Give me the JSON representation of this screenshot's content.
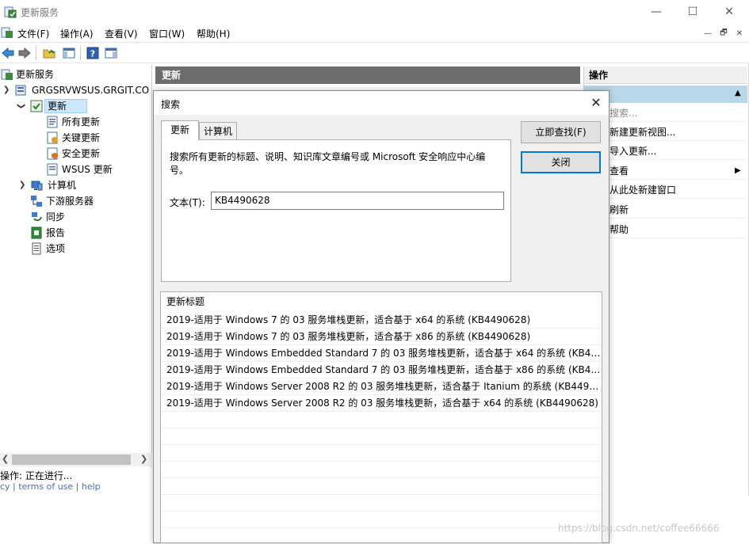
{
  "app": {
    "title": "更新服务",
    "colors": {
      "accent": "#0078d7",
      "selection": "#cce8ff",
      "header_dark": "#6c6c6c",
      "action_section": "#b9d7ea"
    }
  },
  "window_controls": {
    "minimize": "—",
    "maximize": "☐",
    "close": "✕"
  },
  "menubar": {
    "items": [
      "文件(F)",
      "操作(A)",
      "查看(V)",
      "窗口(W)",
      "帮助(H)"
    ]
  },
  "mdi_controls": [
    "—",
    "🗗",
    "✕"
  ],
  "toolbar": {
    "icons": [
      "back-arrow-icon",
      "forward-arrow-icon",
      "up-folder-icon",
      "show-hide-tree-icon",
      "help-icon",
      "show-hide-action-pane-icon"
    ]
  },
  "tree": {
    "root": "更新服务",
    "server": "GRGSRVWSUS.GRGIT.CO",
    "updates": "更新",
    "all_updates": "所有更新",
    "critical_updates": "关键更新",
    "security_updates": "安全更新",
    "wsus_updates": "WSUS 更新",
    "computers": "计算机",
    "downstream_servers": "下游服务器",
    "sync": "同步",
    "reports": "报告",
    "options": "选项"
  },
  "center": {
    "header": "更新"
  },
  "actions": {
    "header": "操作",
    "items": [
      "搜索...",
      "新建更新视图...",
      "导入更新...",
      "查看",
      "从此处新建窗口",
      "刷新",
      "帮助"
    ]
  },
  "status": {
    "text": "操作:  正在进行..."
  },
  "behind_links": {
    "text": "cy  |  terms of use  |  help"
  },
  "dialog": {
    "title": "搜索",
    "close": "✕",
    "tabs": [
      "更新",
      "计算机"
    ],
    "description": "搜索所有更新的标题、说明、知识库文章编号或 Microsoft 安全响应中心编号。",
    "text_label": "文本(T):",
    "text_value": "KB4490628",
    "find_now_button": "立即查找(F)",
    "close_button": "关闭",
    "results_header": "更新标题",
    "results": [
      "2019-适用于 Windows 7 的 03 服务堆栈更新，适合基于 x64 的系统 (KB4490628)",
      "2019-适用于 Windows 7 的 03 服务堆栈更新，适合基于 x86 的系统 (KB4490628)",
      "2019-适用于 Windows Embedded Standard 7 的 03 服务堆栈更新，适合基于 x64 的系统 (KB44...",
      "2019-适用于 Windows Embedded Standard 7 的 03 服务堆栈更新，适合基于 x86 的系统 (KB44...",
      "2019-适用于 Windows Server 2008 R2 的 03 服务堆栈更新，适合基于 Itanium 的系统 (KB44906...",
      "2019-适用于 Windows Server 2008 R2 的 03 服务堆栈更新，适合基于 x64 的系统 (KB4490628)"
    ]
  },
  "watermark": "https://blog.csdn.net/coffee66666"
}
